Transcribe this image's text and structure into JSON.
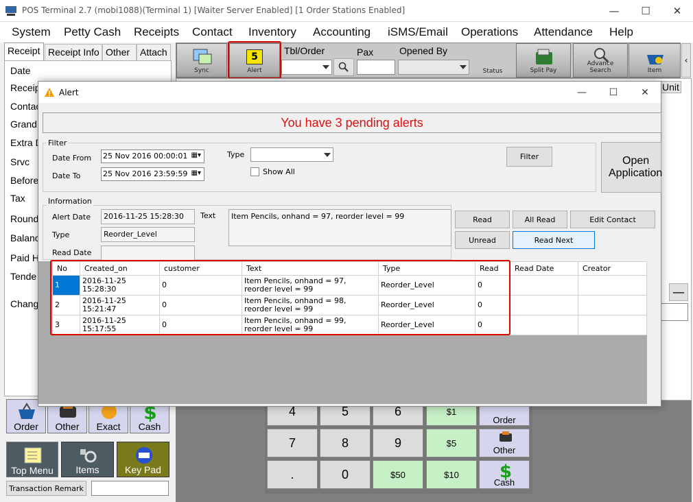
{
  "app": {
    "title": "POS Terminal 2.7 (mobi1088)(Terminal 1) [Waiter Server Enabled] [1 Order Stations Enabled]"
  },
  "menu": [
    "System",
    "Petty Cash",
    "Receipts",
    "Contact",
    "Inventory",
    "Accounting",
    "iSMS/Email",
    "Operations",
    "Attendance",
    "Help"
  ],
  "left_tabs": [
    "Receipt",
    "Receipt Info",
    "Other",
    "Attach"
  ],
  "left_fields": [
    "Date",
    "Receip",
    "Contac",
    "Grand",
    "Extra D",
    "Srvc",
    "Before",
    "Tax",
    "Round",
    "Balanc",
    "Paid H",
    "Tende",
    "Chang"
  ],
  "bottom_buttons": {
    "order": "Order",
    "other": "Other",
    "exact": "Exact",
    "cash": "Cash",
    "top_menu": "Top Menu",
    "items": "Items",
    "key_pad": "Key Pad",
    "transaction_remark": "Transaction Remark"
  },
  "toolbar": {
    "sync": "Sync",
    "alert": "Alert",
    "alert_count": "5",
    "tbl_order": "Tbl/Order",
    "pax": "Pax",
    "opened_by": "Opened By",
    "status": "Status",
    "split_pay": "Split Pay",
    "advance_search_1": "Advance",
    "advance_search_2": "Search",
    "item": "Item",
    "scroll": "‹"
  },
  "right_fragment": {
    "unit": "Unit"
  },
  "keypad": {
    "k4": "4",
    "k5": "5",
    "k6": "6",
    "k7": "7",
    "k8": "8",
    "k9": "9",
    "kdot": ".",
    "k0": "0",
    "d1": "$1",
    "d5": "$5",
    "d10": "$10",
    "d50": "$50",
    "order": "Order",
    "other": "Other",
    "cash": "Cash"
  },
  "dialog": {
    "title": "Alert",
    "banner": "You have 3 pending alerts",
    "filter_group": "Filter",
    "date_from_label": "Date From",
    "date_from": "25 Nov 2016 00:00:01",
    "date_to_label": "Date To",
    "date_to": "25 Nov 2016 23:59:59",
    "type_label": "Type",
    "show_all": "Show All",
    "filter_button": "Filter",
    "open_app_1": "Open",
    "open_app_2": "Application",
    "info_group": "Information",
    "alert_date_label": "Alert Date",
    "alert_date": "2016-11-25 15:28:30",
    "type_info_label": "Type",
    "type_value": "Reorder_Level",
    "read_date_label": "Read Date",
    "text_label": "Text",
    "text_value": "Item Pencils, onhand = 97, reorder level = 99",
    "read": "Read",
    "all_read": "All Read",
    "edit_contact": "Edit Contact",
    "unread": "Unread",
    "read_next": "Read Next"
  },
  "grid": {
    "columns": [
      "No",
      "Created_on",
      "customer",
      "Text",
      "Type",
      "Read",
      "Read Date",
      "Creator"
    ],
    "rows": [
      {
        "no": "1",
        "created": "2016-11-25 15:28:30",
        "customer": "0",
        "text": "Item Pencils, onhand = 97, reorder level = 99",
        "type": "Reorder_Level",
        "read": "0",
        "read_date": "",
        "creator": ""
      },
      {
        "no": "2",
        "created": "2016-11-25 15:21:47",
        "customer": "0",
        "text": "Item Pencils, onhand = 98, reorder level = 99",
        "type": "Reorder_Level",
        "read": "0",
        "read_date": "",
        "creator": ""
      },
      {
        "no": "3",
        "created": "2016-11-25 15:17:55",
        "customer": "0",
        "text": "Item Pencils, onhand = 99, reorder level = 99",
        "type": "Reorder_Level",
        "read": "0",
        "read_date": "",
        "creator": ""
      }
    ]
  },
  "colors": {
    "alert_red": "#e01010",
    "highlight_red": "#e00000",
    "alert_badge": "#f5e600",
    "pad_blue": "#d5d5ee",
    "pad_green": "#c6f0c6"
  }
}
